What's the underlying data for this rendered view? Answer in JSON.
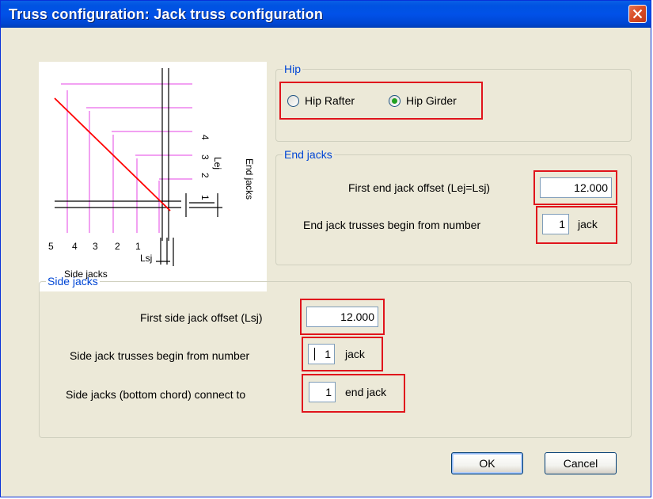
{
  "window": {
    "title": "Truss configuration: Jack truss configuration"
  },
  "diagram": {
    "end_numbers": [
      "4",
      "3",
      "2",
      "1"
    ],
    "side_numbers": [
      "5",
      "4",
      "3",
      "2",
      "1"
    ],
    "lej_label": "Lej",
    "lsj_label": "Lsj",
    "end_jacks_label": "End jacks",
    "side_jacks_label": "Side jacks",
    "colors": {
      "jacks": "#ee82ee",
      "hip": "#ff0000",
      "wall": "#000000"
    }
  },
  "hip": {
    "legend": "Hip",
    "options": [
      {
        "label": "Hip Rafter",
        "selected": false
      },
      {
        "label": "Hip Girder",
        "selected": true
      }
    ]
  },
  "end_jacks": {
    "legend": "End jacks",
    "offset_label": "First end jack offset (Lej=Lsj)",
    "offset_value": "12.000",
    "begin_label": "End jack trusses begin from number",
    "begin_value": "1",
    "begin_unit": "jack"
  },
  "side_jacks": {
    "legend": "Side jacks",
    "offset_label": "First side jack offset (Lsj)",
    "offset_value": "12.000",
    "begin_label": "Side jack trusses begin from number",
    "begin_value": "1",
    "begin_unit": "jack",
    "connect_label": "Side jacks (bottom chord) connect to",
    "connect_value": "1",
    "connect_unit": "end jack"
  },
  "buttons": {
    "ok": "OK",
    "cancel": "Cancel"
  },
  "accent": {
    "highlight": "#e0141c",
    "legend": "#0046d5",
    "radio_dot": "#21a121"
  }
}
